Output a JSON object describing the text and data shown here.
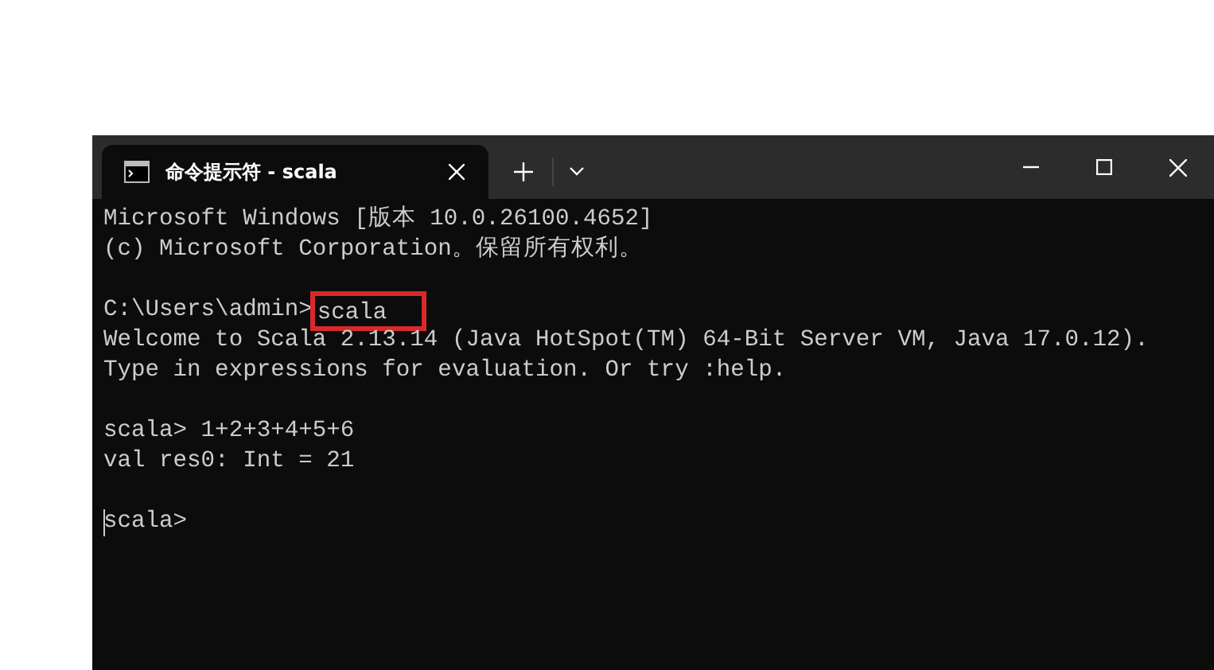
{
  "window": {
    "tab": {
      "title": "命令提示符 - scala",
      "selected": true
    }
  },
  "terminal": {
    "lines": [
      {
        "kind": "output",
        "text": "Microsoft Windows [版本 10.0.26100.4652]"
      },
      {
        "kind": "output",
        "text": "(c) Microsoft Corporation。保留所有权利。"
      },
      {
        "kind": "blank"
      },
      {
        "kind": "command",
        "prompt": "C:\\Users\\admin>",
        "command": "scala",
        "highlighted": true
      },
      {
        "kind": "output",
        "text": "Welcome to Scala 2.13.14 (Java HotSpot(TM) 64-Bit Server VM, Java 17.0.12)."
      },
      {
        "kind": "output",
        "text": "Type in expressions for evaluation. Or try :help."
      },
      {
        "kind": "blank"
      },
      {
        "kind": "output",
        "text": "scala> 1+2+3+4+5+6"
      },
      {
        "kind": "output",
        "text": "val res0: Int = 21"
      },
      {
        "kind": "blank"
      },
      {
        "kind": "input",
        "prompt": "scala>",
        "cursor": true
      }
    ]
  }
}
